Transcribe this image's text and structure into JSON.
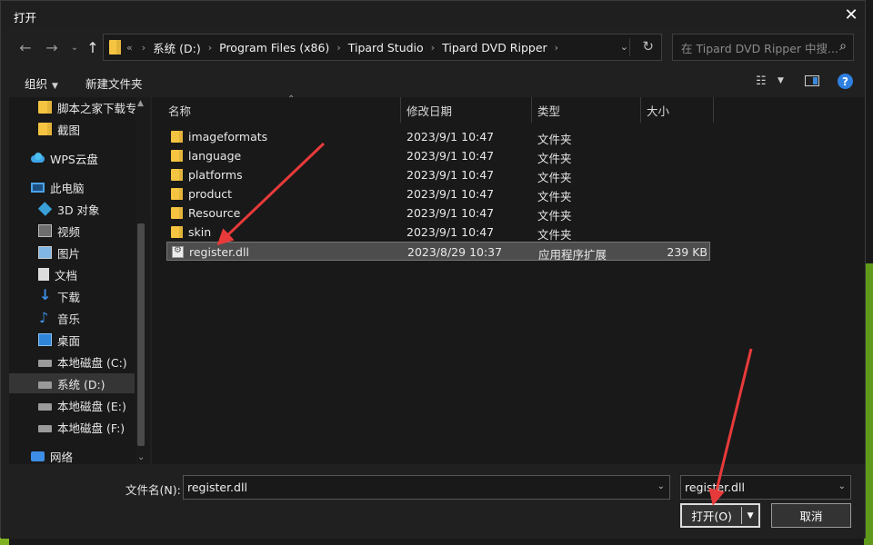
{
  "window": {
    "title": "打开",
    "close_icon": "close-icon"
  },
  "nav": {
    "back_icon": "arrow-left-icon",
    "forward_icon": "arrow-right-icon",
    "recent_icon": "chevron-down-icon",
    "up_icon": "arrow-up-icon",
    "breadcrumb_overflow": "«",
    "breadcrumbs": [
      "系统 (D:)",
      "Program Files (x86)",
      "Tipard Studio",
      "Tipard DVD Ripper"
    ],
    "search_placeholder": "在 Tipard DVD Ripper 中搜..."
  },
  "toolbar": {
    "organize": "组织",
    "new_folder": "新建文件夹"
  },
  "sidebar": {
    "items": [
      {
        "label": "脚本之家下载专用",
        "icon": "folder-icon"
      },
      {
        "label": "截图",
        "icon": "folder-icon"
      },
      {
        "label": "WPS云盘",
        "icon": "cloud-icon"
      },
      {
        "label": "此电脑",
        "icon": "computer-icon"
      },
      {
        "label": "3D 对象",
        "icon": "3d-objects-icon"
      },
      {
        "label": "视频",
        "icon": "video-icon"
      },
      {
        "label": "图片",
        "icon": "pictures-icon"
      },
      {
        "label": "文档",
        "icon": "documents-icon"
      },
      {
        "label": "下载",
        "icon": "download-icon"
      },
      {
        "label": "音乐",
        "icon": "music-icon"
      },
      {
        "label": "桌面",
        "icon": "desktop-icon"
      },
      {
        "label": "本地磁盘 (C:)",
        "icon": "drive-icon"
      },
      {
        "label": "系统 (D:)",
        "icon": "drive-icon",
        "selected": true
      },
      {
        "label": "本地磁盘 (E:)",
        "icon": "drive-icon"
      },
      {
        "label": "本地磁盘 (F:)",
        "icon": "drive-icon"
      },
      {
        "label": "网络",
        "icon": "network-icon"
      }
    ]
  },
  "files": {
    "columns": [
      "名称",
      "修改日期",
      "类型",
      "大小"
    ],
    "rows": [
      {
        "name": "imageformats",
        "date": "2023/9/1 10:47",
        "type": "文件夹",
        "size": "",
        "icon": "folder-icon"
      },
      {
        "name": "language",
        "date": "2023/9/1 10:47",
        "type": "文件夹",
        "size": "",
        "icon": "folder-icon"
      },
      {
        "name": "platforms",
        "date": "2023/9/1 10:47",
        "type": "文件夹",
        "size": "",
        "icon": "folder-icon"
      },
      {
        "name": "product",
        "date": "2023/9/1 10:47",
        "type": "文件夹",
        "size": "",
        "icon": "folder-icon"
      },
      {
        "name": "Resource",
        "date": "2023/9/1 10:47",
        "type": "文件夹",
        "size": "",
        "icon": "folder-icon"
      },
      {
        "name": "skin",
        "date": "2023/9/1 10:47",
        "type": "文件夹",
        "size": "",
        "icon": "folder-icon"
      },
      {
        "name": "register.dll",
        "date": "2023/8/29 10:37",
        "type": "应用程序扩展",
        "size": "239 KB",
        "icon": "dll-file-icon",
        "selected": true
      }
    ]
  },
  "bottom": {
    "filename_label": "文件名(N):",
    "filename_value": "register.dll",
    "filetype_value": "register.dll",
    "open_label": "打开(O)",
    "cancel_label": "取消"
  },
  "colors": {
    "folder": "#f5c542",
    "accent": "#2f7fe0",
    "annotation_arrow": "#e83a3a"
  }
}
